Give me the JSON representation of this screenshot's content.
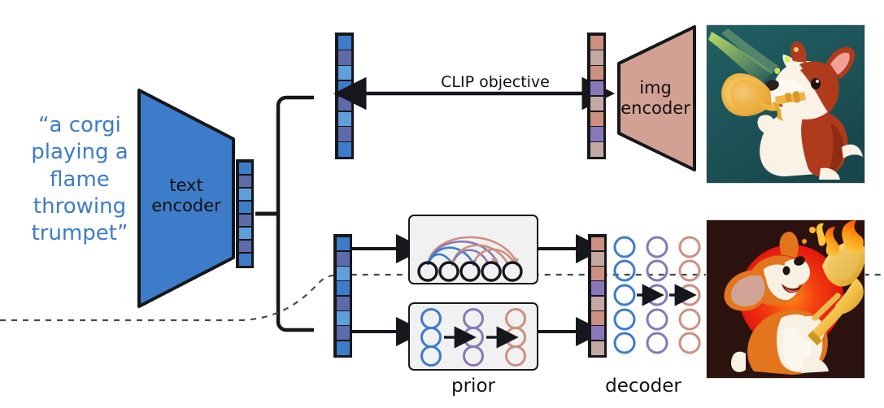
{
  "diagram": {
    "title": "unCLIP / DALL-E 2 architecture",
    "prompt": {
      "text": "“a corgi\nplaying a\nflame\nthrowing\ntrumpet”",
      "color": "#3d7cc9"
    },
    "encoders": {
      "text_encoder": {
        "label": "text\nencoder",
        "fill": "#3d7cc9",
        "stroke": "#15171c"
      },
      "img_encoder": {
        "label": "img\nencoder",
        "fill": "#d3a193",
        "stroke": "#15171c"
      }
    },
    "objective": {
      "label": "CLIP objective"
    },
    "captions": {
      "prior": "prior",
      "decoder": "decoder"
    },
    "embeddings": {
      "text_embedding": {
        "name": "text embedding",
        "cells": [
          "#3d7cc9",
          "#5f6aa8",
          "#5fa0dc",
          "#3d7cc9",
          "#5f6aa8",
          "#5fa0dc",
          "#5f6aa8",
          "#3d7cc9"
        ]
      },
      "clip_text_embedding": {
        "name": "CLIP text embedding",
        "cells": [
          "#3d7cc9",
          "#5f6aa8",
          "#5fa0dc",
          "#3d7cc9",
          "#5f6aa8",
          "#5fa0dc",
          "#5f6aa8",
          "#3d7cc9"
        ]
      },
      "prior_input_embedding": {
        "name": "text embedding to prior",
        "cells": [
          "#3d7cc9",
          "#5f6aa8",
          "#5fa0dc",
          "#3d7cc9",
          "#5f6aa8",
          "#5fa0dc",
          "#5f6aa8",
          "#3d7cc9"
        ]
      },
      "clip_image_embedding": {
        "name": "CLIP image embedding",
        "cells": [
          "#cc9080",
          "#c4a8a4",
          "#cc9080",
          "#8878b8",
          "#c4a8a4",
          "#cc9080",
          "#8878b8",
          "#c4a8a4"
        ]
      },
      "decoder_input_embedding": {
        "name": "image embedding to decoder",
        "cells": [
          "#cc9080",
          "#c4a8a4",
          "#cc9080",
          "#8878b8",
          "#c4a8a4",
          "#cc9080",
          "#8878b8",
          "#c4a8a4"
        ]
      }
    },
    "prior_ar": {
      "name": "autoregressive prior",
      "nodes": 5,
      "arc_colors": [
        "#cc9080",
        "#8878b8",
        "#3d7cc9",
        "#cc9080",
        "#8878b8",
        "#3d7cc9",
        "#cc9080"
      ]
    },
    "prior_diffusion": {
      "name": "diffusion prior",
      "columns": [
        {
          "color": "#3d7cc9",
          "count": 3
        },
        {
          "color": "#8878b8",
          "count": 3
        },
        {
          "color": "#cc9080",
          "count": 3
        }
      ]
    },
    "decoder_net": {
      "name": "diffusion decoder",
      "columns": [
        {
          "color": "#3d7cc9",
          "count": 5
        },
        {
          "color": "#8878b8",
          "count": 5
        },
        {
          "color": "#cc9080",
          "count": 5
        }
      ]
    },
    "images": {
      "top": {
        "name": "corgi playing a trumpet",
        "background": "#1d5358"
      },
      "bottom": {
        "name": "corgi playing a flaming trombone",
        "background": "#2b120f",
        "sun": "#e8201c"
      }
    },
    "separator": {
      "name": "training / inference divider",
      "style": "dashed"
    }
  }
}
